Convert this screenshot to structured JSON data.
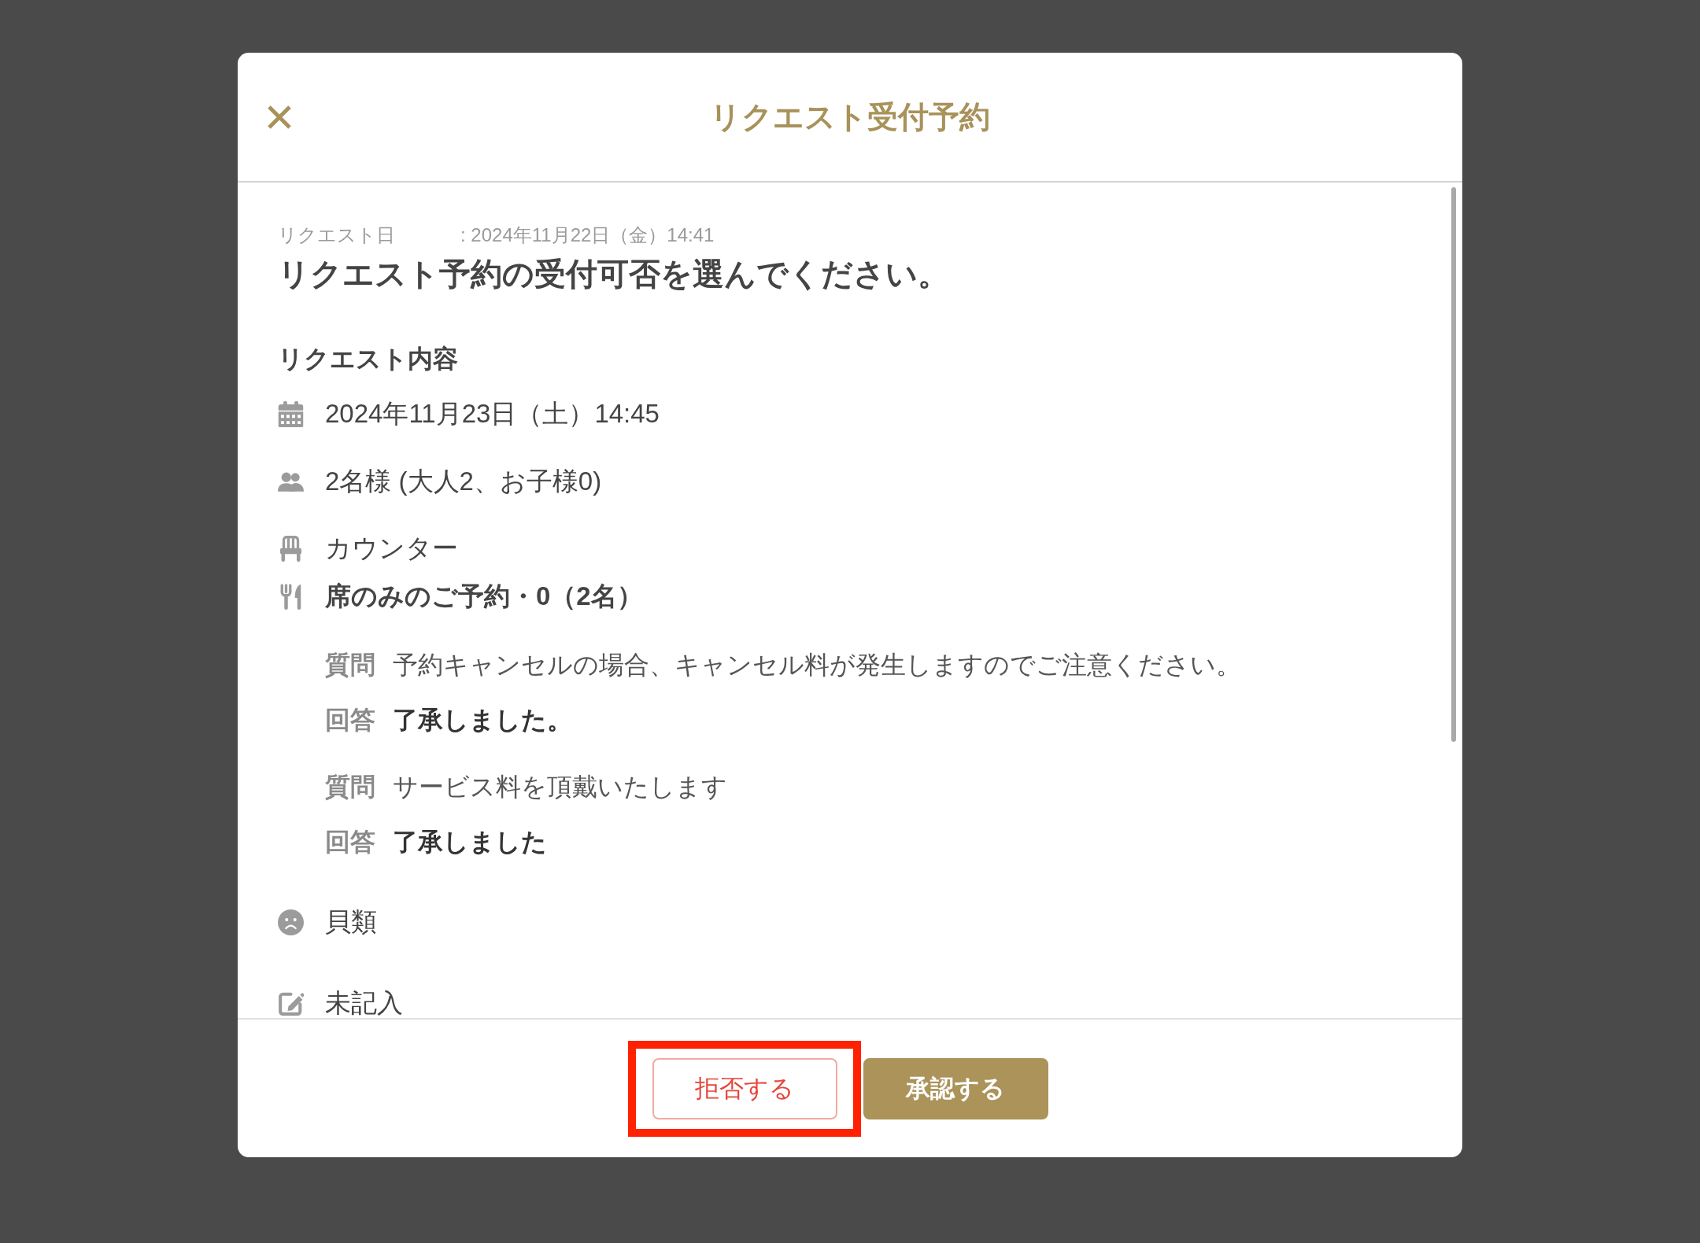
{
  "header": {
    "title": "リクエスト受付予約"
  },
  "request_date": {
    "label": "リクエスト日",
    "value": ": 2024年11月22日（金）14:41"
  },
  "prompt": "リクエスト予約の受付可否を選んでください。",
  "section_title": "リクエスト内容",
  "details": [
    {
      "kind": "date",
      "text": "2024年11月23日（土）14:45"
    },
    {
      "kind": "guests",
      "text": "2名様 (大人2、お子様0)"
    },
    {
      "kind": "seat",
      "text": "カウンター"
    },
    {
      "kind": "course",
      "text": "席のみのご予約・0（2名）",
      "qa": [
        {
          "question_label": "質問",
          "question": "予約キャンセルの場合、キャンセル料が発生しますのでご注意ください。",
          "answer_label": "回答",
          "answer": "了承しました。"
        },
        {
          "question_label": "質問",
          "question": "サービス料を頂戴いたします",
          "answer_label": "回答",
          "answer": "了承しました"
        }
      ]
    },
    {
      "kind": "allergy",
      "text": "貝類"
    },
    {
      "kind": "notes",
      "text": "未記入"
    }
  ],
  "footer": {
    "buttons": [
      {
        "kind": "reject",
        "label": "拒否する",
        "highlighted": true
      },
      {
        "kind": "approve",
        "label": "承認する",
        "highlighted": false
      }
    ]
  }
}
